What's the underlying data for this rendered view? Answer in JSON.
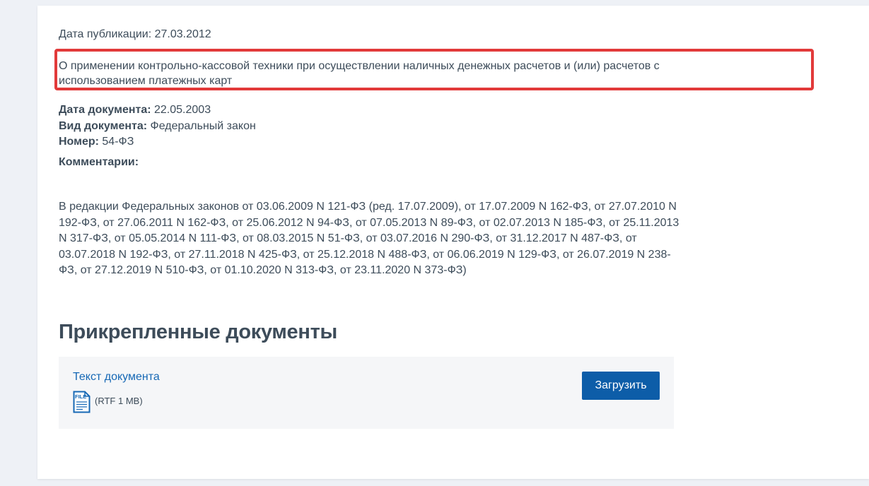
{
  "document": {
    "publication_date": "Дата публикации: 27.03.2012",
    "title": "О применении контрольно-кассовой техники при осуществлении наличных денежных расчетов и (или) расчетов с использованием платежных карт",
    "meta": {
      "doc_date_label": "Дата документа:",
      "doc_date_value": " 22.05.2003",
      "doc_type_label": "Вид документа:",
      "doc_type_value": " Федеральный закон",
      "number_label": "Номер:",
      "number_value": " 54-ФЗ"
    },
    "comments_label": "Комментарии:",
    "revisions": "В редакции Федеральных законов от 03.06.2009 N 121-ФЗ (ред. 17.07.2009), от 17.07.2009 N 162-ФЗ, от 27.07.2010 N 192-ФЗ, от 27.06.2011 N 162-ФЗ, от 25.06.2012 N 94-ФЗ, от 07.05.2013 N 89-ФЗ, от 02.07.2013 N 185-ФЗ, от 25.11.2013 N 317-ФЗ, от 05.05.2014 N 111-ФЗ, от 08.03.2015 N 51-ФЗ, от 03.07.2016 N 290-ФЗ, от 31.12.2017 N 487-ФЗ, от 03.07.2018 N 192-ФЗ, от 27.11.2018 N 425-ФЗ, от 25.12.2018 N 488-ФЗ, от 06.06.2019 N 129-ФЗ, от 26.07.2019 N 238-ФЗ, от 27.12.2019 N 510-ФЗ, от 01.10.2020 N 313-ФЗ, от 23.11.2020 N 373-ФЗ)"
  },
  "attachments": {
    "heading": "Прикрепленные документы",
    "files": [
      {
        "link_label": "Текст документа",
        "icon": "file-icon",
        "icon_text": "FILE",
        "size": "(RTF 1 MB)",
        "download_label": "Загрузить"
      }
    ]
  },
  "colors": {
    "highlight_border": "#e23a3a",
    "link": "#1668b5",
    "button": "#0d5da8",
    "text": "#3d4c5a"
  }
}
